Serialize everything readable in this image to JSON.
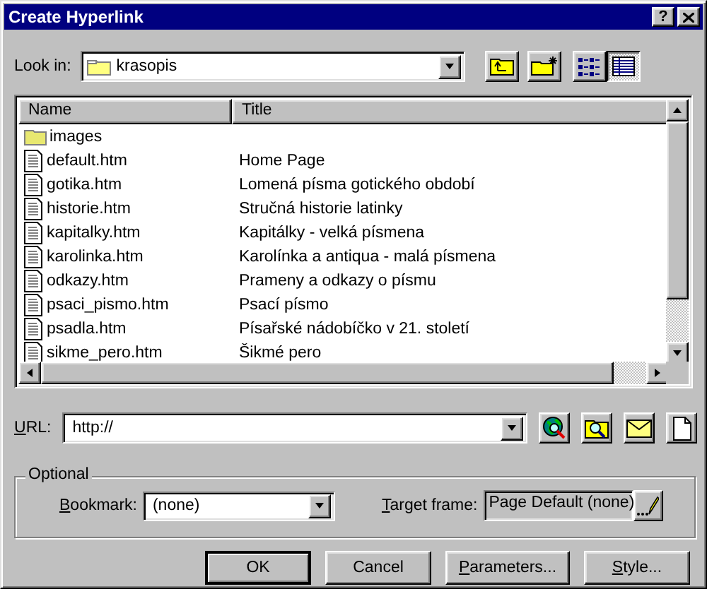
{
  "window": {
    "title": "Create Hyperlink",
    "help_button": "?"
  },
  "look_in": {
    "label": "Look in:",
    "value": "krasopis"
  },
  "toolbar": [
    {
      "kind": "up_folder",
      "selected": false
    },
    {
      "kind": "new_folder",
      "selected": false
    },
    {
      "kind": "list_view",
      "selected": false
    },
    {
      "kind": "details_view",
      "selected": true
    }
  ],
  "file_list": {
    "columns": [
      "Name",
      "Title"
    ],
    "rows": [
      {
        "kind": "folder",
        "name": "images",
        "title": ""
      },
      {
        "kind": "file",
        "name": "default.htm",
        "title": "Home Page"
      },
      {
        "kind": "file",
        "name": "gotika.htm",
        "title": "Lomená písma gotického období"
      },
      {
        "kind": "file",
        "name": "historie.htm",
        "title": "Stručná historie latinky"
      },
      {
        "kind": "file",
        "name": "kapitalky.htm",
        "title": "Kapitálky - velká písmena"
      },
      {
        "kind": "file",
        "name": "karolinka.htm",
        "title": "Karolínka a antiqua - malá písmena"
      },
      {
        "kind": "file",
        "name": "odkazy.htm",
        "title": "Prameny a odkazy o písmu"
      },
      {
        "kind": "file",
        "name": "psaci_pismo.htm",
        "title": "Psací písmo"
      },
      {
        "kind": "file",
        "name": "psadla.htm",
        "title": "Písařské nádobíčko v 21. století"
      },
      {
        "kind": "file",
        "name": "sikme_pero.htm",
        "title": "Šikmé pero"
      }
    ]
  },
  "url": {
    "label_key": "U",
    "label_rest": "RL:",
    "value": "http://"
  },
  "url_buttons": [
    {
      "kind": "web"
    },
    {
      "kind": "file"
    },
    {
      "kind": "email"
    },
    {
      "kind": "new_page"
    }
  ],
  "optional": {
    "legend": "Optional",
    "bookmark": {
      "label_key": "B",
      "label_rest": "ookmark:",
      "value": "(none)"
    },
    "target_frame": {
      "label_key": "T",
      "label_rest": "arget frame:",
      "value": "Page Default (none)"
    }
  },
  "buttons": [
    {
      "rest": "OK",
      "default": true
    },
    {
      "rest": "Cancel",
      "default": false
    },
    {
      "key": "P",
      "rest": "arameters...",
      "default": false
    },
    {
      "key": "S",
      "rest": "tyle...",
      "default": false
    }
  ]
}
